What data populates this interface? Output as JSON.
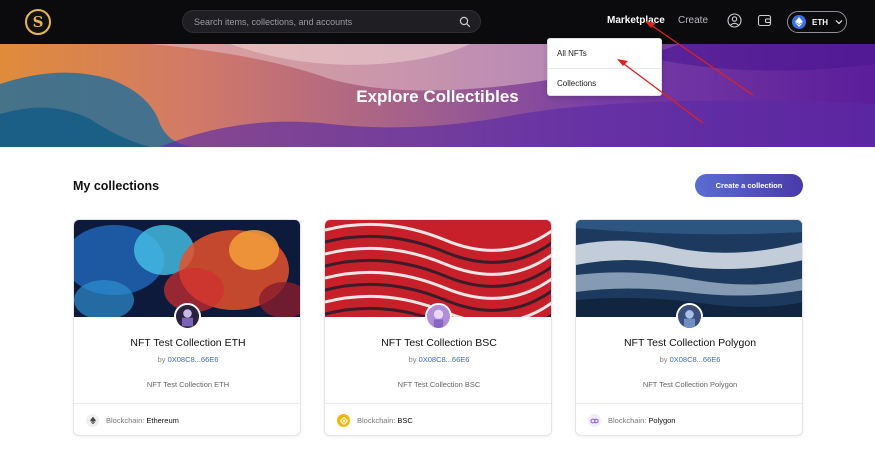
{
  "header": {
    "logo": "S",
    "search_placeholder": "Search items, collections, and accounts",
    "nav": {
      "marketplace": "Marketplace",
      "create": "Create"
    },
    "network": "ETH"
  },
  "hero": {
    "title": "Explore Collectibles"
  },
  "dropdown": {
    "items": [
      "All NFTs",
      "Collections"
    ]
  },
  "section": {
    "title": "My collections",
    "create_button": "Create a collection"
  },
  "collections": [
    {
      "title": "NFT Test Collection ETH",
      "by_prefix": "by",
      "owner": "0X08C8...66E6",
      "description": "NFT Test Collection ETH",
      "chain_label": "Blockchain:",
      "chain": "Ethereum",
      "chain_icon": "ethereum-icon"
    },
    {
      "title": "NFT Test Collection BSC",
      "by_prefix": "by",
      "owner": "0X08C8...66E6",
      "description": "NFT Test Collection BSC",
      "chain_label": "Blockchain:",
      "chain": "BSC",
      "chain_icon": "bnb-icon"
    },
    {
      "title": "NFT Test Collection Polygon",
      "by_prefix": "by",
      "owner": "0X08C8...66E6",
      "description": "NFT Test Collection Polygon",
      "chain_label": "Blockchain:",
      "chain": "Polygon",
      "chain_icon": "polygon-icon"
    }
  ],
  "colors": {
    "accent": "#3f66d6",
    "button_start": "#5b6ed3",
    "button_end": "#4a3aa8",
    "annotation_arrow": "#e02020",
    "nav_bg": "#0b0b0d"
  }
}
